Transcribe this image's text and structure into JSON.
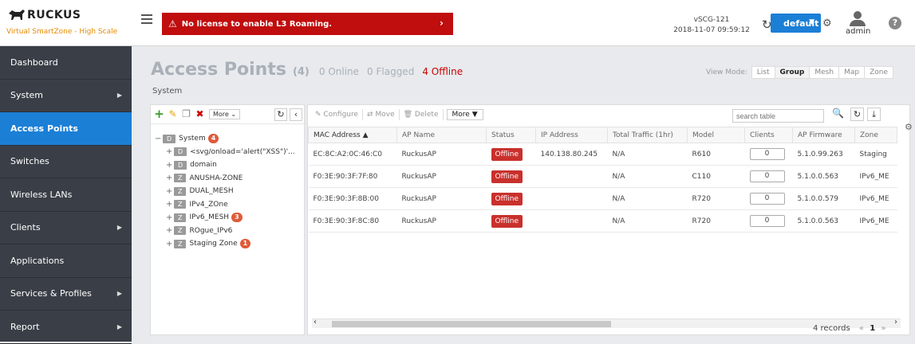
{
  "header": {
    "brand": "RUCKUS",
    "product": "Virtual SmartZone - High Scale",
    "alert_text": "No license to enable L3 Roaming.",
    "system_name": "vSCG-121",
    "system_time": "2018-11-07 09:59:12",
    "domain_label": "default",
    "user_label": "admin",
    "help_label": "?"
  },
  "sidebar": {
    "items": [
      {
        "label": "Dashboard",
        "has_submenu": false
      },
      {
        "label": "System",
        "has_submenu": true
      },
      {
        "label": "Access Points",
        "has_submenu": false,
        "active": true
      },
      {
        "label": "Switches",
        "has_submenu": false
      },
      {
        "label": "Wireless LANs",
        "has_submenu": false
      },
      {
        "label": "Clients",
        "has_submenu": true
      },
      {
        "label": "Applications",
        "has_submenu": false
      },
      {
        "label": "Services & Profiles",
        "has_submenu": true
      },
      {
        "label": "Report",
        "has_submenu": true
      }
    ]
  },
  "page": {
    "title": "Access Points",
    "count": "(4)",
    "online": "0 Online",
    "flagged": "0 Flagged",
    "offline": "4 Offline",
    "view_mode_label": "View Mode:",
    "view_modes": [
      "List",
      "Group",
      "Mesh",
      "Map",
      "Zone"
    ],
    "selected_view": "Group",
    "breadcrumb": "System"
  },
  "tree_toolbar": {
    "more_label": "More"
  },
  "tree": {
    "nodes": [
      {
        "toggle": "−",
        "badge": "D",
        "label": "System",
        "count": "4"
      },
      {
        "toggle": "+",
        "badge": "D",
        "label": "<svg/onload='alert(\"XSS\")'...",
        "count": ""
      },
      {
        "toggle": "+",
        "badge": "D",
        "label": "domain",
        "count": ""
      },
      {
        "toggle": "+",
        "badge": "Z",
        "label": "ANUSHA-ZONE",
        "count": ""
      },
      {
        "toggle": "+",
        "badge": "Z",
        "label": "DUAL_MESH",
        "count": ""
      },
      {
        "toggle": "+",
        "badge": "Z",
        "label": "IPv4_ZOne",
        "count": ""
      },
      {
        "toggle": "+",
        "badge": "Z",
        "label": "IPv6_MESH",
        "count": "3"
      },
      {
        "toggle": "+",
        "badge": "Z",
        "label": "ROgue_IPv6",
        "count": ""
      },
      {
        "toggle": "+",
        "badge": "Z",
        "label": "Staging Zone",
        "count": "1"
      }
    ]
  },
  "grid_toolbar": {
    "configure": "Configure",
    "move": "Move",
    "delete": "Delete",
    "more": "More",
    "search_placeholder": "search table"
  },
  "table": {
    "columns": [
      "MAC Address",
      "AP Name",
      "Status",
      "IP Address",
      "Total Traffic (1hr)",
      "Model",
      "Clients",
      "AP Firmware",
      "Zone"
    ],
    "sort_indicator": "▲",
    "rows": [
      {
        "mac": "EC:8C:A2:0C:46:C0",
        "name": "RuckusAP",
        "status": "Offline",
        "ip": "140.138.80.245",
        "traffic": "N/A",
        "model": "R610",
        "clients": "0",
        "firmware": "5.1.0.99.263",
        "zone": "Staging"
      },
      {
        "mac": "F0:3E:90:3F:7F:80",
        "name": "RuckusAP",
        "status": "Offline",
        "ip": "",
        "traffic": "N/A",
        "model": "C110",
        "clients": "0",
        "firmware": "5.1.0.0.563",
        "zone": "IPv6_ME"
      },
      {
        "mac": "F0:3E:90:3F:8B:00",
        "name": "RuckusAP",
        "status": "Offline",
        "ip": "",
        "traffic": "N/A",
        "model": "R720",
        "clients": "0",
        "firmware": "5.1.0.0.579",
        "zone": "IPv6_ME"
      },
      {
        "mac": "F0:3E:90:3F:8C:80",
        "name": "RuckusAP",
        "status": "Offline",
        "ip": "",
        "traffic": "N/A",
        "model": "R720",
        "clients": "0",
        "firmware": "5.1.0.0.563",
        "zone": "IPv6_ME"
      }
    ]
  },
  "footer": {
    "records": "4 records",
    "prev": "«",
    "page": "1",
    "next": "»"
  },
  "colors": {
    "accent": "#1b7fd6",
    "alert": "#c00d0d",
    "offline": "#c9302c",
    "sidebar": "#3a3f47"
  }
}
